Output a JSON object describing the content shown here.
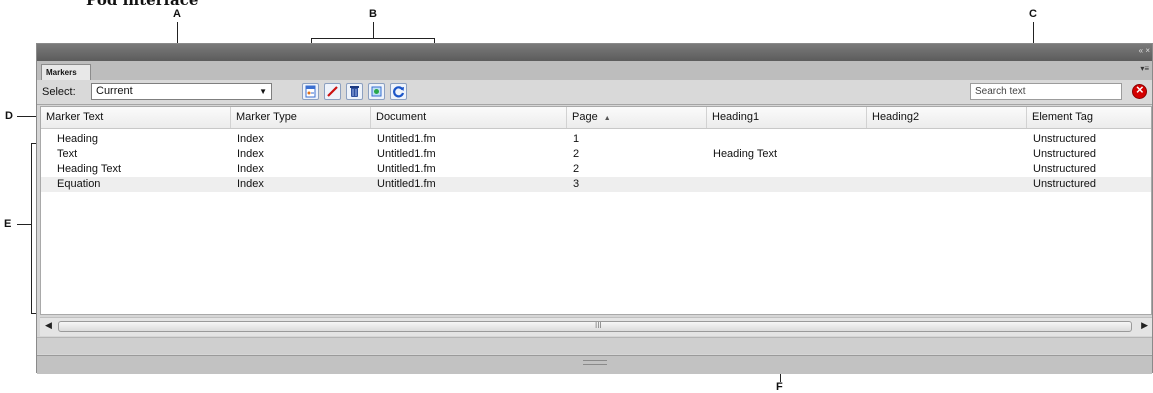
{
  "figure": {
    "title": "Pod interface",
    "callouts": {
      "a": "A",
      "b": "B",
      "c": "C",
      "d": "D",
      "e": "E",
      "f": "F"
    }
  },
  "window": {
    "title_buttons": "« ×",
    "tab": "Markers",
    "tab_menu": "▾≡"
  },
  "toolbar": {
    "select_label": "Select:",
    "select_value": "Current",
    "buttons": [
      {
        "name": "edit-marker-icon"
      },
      {
        "name": "pencil-icon"
      },
      {
        "name": "delete-icon"
      },
      {
        "name": "insert-icon"
      },
      {
        "name": "refresh-icon"
      }
    ],
    "search_placeholder": "Search text"
  },
  "table": {
    "columns": [
      "Marker Text",
      "Marker Type",
      "Document",
      "Page",
      "Heading1",
      "Heading2",
      "Element Tag"
    ],
    "sorted_column": "Page",
    "sort_indicator": "▲",
    "rows": [
      [
        "Heading",
        "Index",
        "Untitled1.fm",
        "1",
        "",
        "",
        "Unstructured"
      ],
      [
        "Text",
        "Index",
        "Untitled1.fm",
        "2",
        "Heading Text",
        "",
        "Unstructured"
      ],
      [
        "Heading Text",
        "Index",
        "Untitled1.fm",
        "2",
        "",
        "",
        "Unstructured"
      ],
      [
        "Equation",
        "Index",
        "Untitled1.fm",
        "3",
        "",
        "",
        "Unstructured"
      ]
    ],
    "selected_row": 3
  },
  "scrollbar": {
    "left_arrow": "◀",
    "right_arrow": "▶",
    "grip": "III"
  },
  "colors": {
    "accent": "#3b6fd0",
    "clear": "#d40000",
    "pencil": "#cc1111"
  }
}
